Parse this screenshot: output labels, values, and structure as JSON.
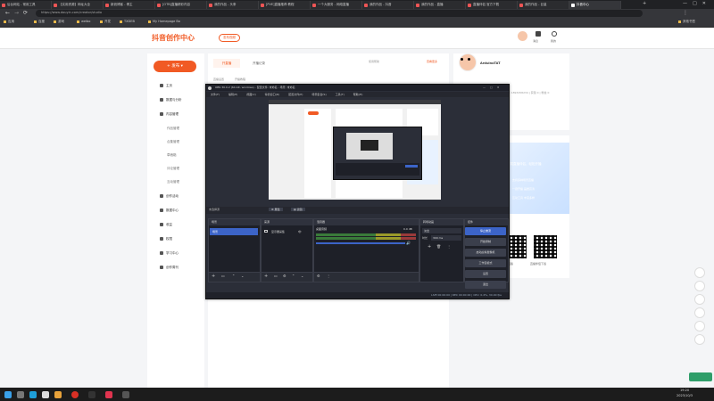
{
  "browser": {
    "tabs": [
      {
        "label": "后台网站 - 常用工具"
      },
      {
        "label": "【实用资源】网址大全"
      },
      {
        "label": "新浪博客 - 博主"
      },
      {
        "label": "[OTB]直播精彩内容"
      },
      {
        "label": "我的作品 - 头条"
      },
      {
        "label": "[PVE]直播推荐 教程"
      },
      {
        "label": "一个大服务 - 网络直播"
      },
      {
        "label": "我的作品 - 抖音"
      },
      {
        "label": "我的作品 - 直播"
      },
      {
        "label": "直播伴侣 官方下载"
      },
      {
        "label": "我的作品 - 巨量"
      },
      {
        "label": "抖音中心"
      }
    ],
    "url": "https://www.douyin.com/creator/studio",
    "bookmarks": [
      "应用",
      "百度",
      "游戏",
      "weibo",
      "开发",
      "TXDEB",
      "My Homepage Bo",
      "其他书签"
    ]
  },
  "site": {
    "logo": "抖音创作中心",
    "upload_btn": "发布视频",
    "header_right": [
      "消息",
      "我的"
    ],
    "create_btn": "发布",
    "nav": [
      {
        "label": "主页",
        "icon": "home-icon"
      },
      {
        "label": "数据与分析",
        "icon": "chart-icon"
      },
      {
        "label": "内容管理",
        "icon": "folder-icon"
      }
    ],
    "subnav": [
      "作品管理",
      "合集管理",
      "草稿箱",
      "评论管理",
      "互动管理"
    ],
    "nav2": [
      {
        "label": "创作活动",
        "icon": "flag-icon"
      },
      {
        "label": "数据中心",
        "icon": "data-icon"
      },
      {
        "label": "收益",
        "icon": "money-icon"
      },
      {
        "label": "权限",
        "icon": "key-icon"
      },
      {
        "label": "学习中心",
        "icon": "book-icon"
      },
      {
        "label": "创作周刊",
        "icon": "news-icon"
      }
    ],
    "content_tabs": [
      "开直播",
      "开播记录"
    ],
    "content_links": [
      "直播设置",
      "开播教程"
    ],
    "content_top_right": [
      "使用帮助",
      "查看更多"
    ],
    "user_name": "ArduinoTAT",
    "user_desc": "id: 1893458234 | 获赞 0 | 粉丝 0",
    "card2_title": "下载直播伴侣，轻松开播",
    "card2_lines": [
      "支持多种场景直播",
      "一键开播 画质高清",
      "互动工具 丰富多样"
    ],
    "qr_labels": [
      "手机版",
      "直播伴侣下载"
    ]
  },
  "obs": {
    "title": "OBS 30.0.2 (64-bit, windows) - 配置文件: 未命名 - 场景: 未命名",
    "menu": [
      "文件(F)",
      "编辑(E)",
      "视图(V)",
      "停靠窗口(D)",
      "配置文件(P)",
      "场景集合(S)",
      "工具(T)",
      "帮助(H)"
    ],
    "source_label": "未选择源",
    "props_btn": "属性",
    "filters_btn": "滤镜",
    "docks": {
      "scenes": {
        "title": "场景",
        "items": [
          "场景"
        ]
      },
      "sources": {
        "title": "来源",
        "items": [
          "显示器采集"
        ]
      },
      "mixer": {
        "title": "混音器",
        "items": [
          "桌面音频"
        ],
        "db": "0.0 dB"
      },
      "transitions": {
        "title": "转场动画",
        "type": "淡出",
        "duration_label": "时长",
        "duration": "300 ms"
      },
      "controls": {
        "title": "控件",
        "buttons": [
          "停止推流",
          "开始录制",
          "启动虚拟摄像机",
          "工作室模式",
          "设置",
          "退出"
        ]
      }
    },
    "status": "LIVE 00:00:00  |  REC 00:00:00  |  CPU: 0.4%, 30.00 fps"
  },
  "taskbar": {
    "time": "19:20",
    "date": "2023/10/3"
  },
  "colors": {
    "brand": "#f15a24",
    "obs_accent": "#3c64c8"
  }
}
